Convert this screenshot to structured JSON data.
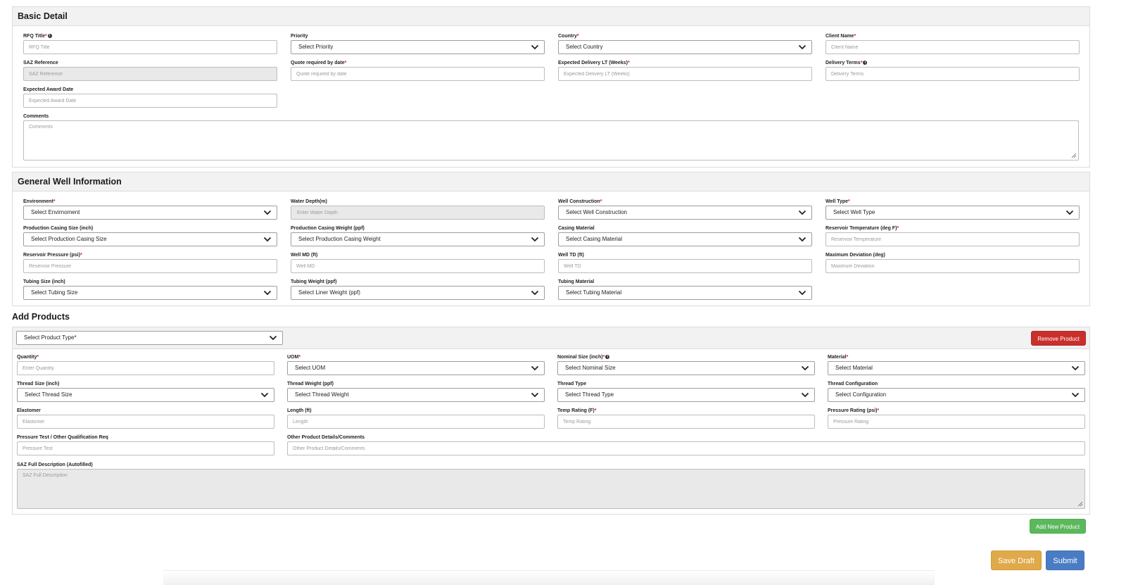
{
  "basic": {
    "title": "Basic Detail",
    "rfq_title": {
      "label": "RFQ Title",
      "placeholder": "RFQ Title"
    },
    "priority": {
      "label": "Priority",
      "value": "Select Priority"
    },
    "country": {
      "label": "Country",
      "value": "Select Country"
    },
    "client_name": {
      "label": "Client Name",
      "placeholder": "Client Name"
    },
    "saz_reference": {
      "label": "SAZ Reference",
      "placeholder": "SAZ Reference"
    },
    "quote_date": {
      "label": "Quote required by date",
      "placeholder": "Quote required by date"
    },
    "delivery_lt": {
      "label": "Expected Delivery LT (Weeks)",
      "placeholder": "Expected Delivery LT (Weeks)"
    },
    "delivery_terms": {
      "label": "Delivery Terms",
      "placeholder": "Delivery Terms"
    },
    "award_date": {
      "label": "Expected Award Date",
      "placeholder": "Expected Award Date"
    },
    "comments": {
      "label": "Comments",
      "placeholder": "Comments"
    }
  },
  "well": {
    "title": "General Well Information",
    "environment": {
      "label": "Environment",
      "value": "Select Envirnoment"
    },
    "water_depth": {
      "label": "Water Depth(m)",
      "placeholder": "Enter Water Depth"
    },
    "well_construction": {
      "label": "Well Construction",
      "value": "Select Well Construction"
    },
    "well_type": {
      "label": "Well Type",
      "value": "Select Well Type"
    },
    "casing_size": {
      "label": "Production Casing Size (inch)",
      "value": "Select Production Casing Size"
    },
    "casing_weight": {
      "label": "Production Casing Weight (ppf)",
      "value": "Select Production Casing Weight"
    },
    "casing_material": {
      "label": "Casing Material",
      "value": "Select Casing Material"
    },
    "reservoir_temp": {
      "label": "Reservoir Temperature (deg F)",
      "placeholder": "Reservoir Temperature"
    },
    "reservoir_pressure": {
      "label": "Reservoir Pressure (psi)",
      "placeholder": "Reservoir Pressure"
    },
    "well_md": {
      "label": "Well MD (ft)",
      "placeholder": "Well MD"
    },
    "well_td": {
      "label": "Well TD (ft)",
      "placeholder": "Well TD"
    },
    "max_deviation": {
      "label": "Maximum Deviation (deg)",
      "placeholder": "Maximum Deviation"
    },
    "tubing_size": {
      "label": "Tubing Size (inch)",
      "value": "Select Tubing Size"
    },
    "tubing_weight": {
      "label": "Tubing Weight (ppf)",
      "value": "Select Liner Weight (ppf)"
    },
    "tubing_material": {
      "label": "Tubing Material",
      "value": "Select Tubing Material"
    }
  },
  "products": {
    "title": "Add Products",
    "product_type": {
      "value": "Select Product Type*"
    },
    "remove_label": "Remove Product",
    "quantity": {
      "label": "Quantity",
      "placeholder": "Enter Quantity"
    },
    "uom": {
      "label": "UOM",
      "value": "Select UOM"
    },
    "nominal_size": {
      "label": "Nominal Size (inch)",
      "value": "Select Nominal Size"
    },
    "material": {
      "label": "Material",
      "value": "Select Material"
    },
    "thread_size": {
      "label": "Thread Size (inch)",
      "value": "Select Thread Size"
    },
    "thread_weight": {
      "label": "Thread Weight (ppf)",
      "value": "Select Thread Weight"
    },
    "thread_type": {
      "label": "Thread Type",
      "value": "Select Thread Type"
    },
    "thread_config": {
      "label": "Thread Configuration",
      "value": "Select Configuration"
    },
    "elastomer": {
      "label": "Elastomer",
      "placeholder": "Elastomer"
    },
    "length": {
      "label": "Length (ft)",
      "placeholder": "Length"
    },
    "temp_rating": {
      "label": "Temp Rating (F)",
      "placeholder": "Temp Rating"
    },
    "pressure_rating": {
      "label": "Pressure Rating (psi)",
      "placeholder": "Pressure Rating"
    },
    "pressure_test": {
      "label": "Pressure Test / Other Qualification Req",
      "placeholder": "Pressure Test"
    },
    "other_details": {
      "label": "Other Product Details/Comments",
      "placeholder": "Other Product Details/Comments"
    },
    "saz_description": {
      "label": "SAZ Full Description (Autofilled)",
      "placeholder": "SAZ Full Description"
    },
    "add_label": "Add New Product"
  },
  "actions": {
    "save_draft_label": "Save Draft",
    "submit_label": "Submit"
  },
  "colors": {
    "remove": "#c9302c",
    "add": "#5cb85c",
    "save_draft": "#e0a94a",
    "submit": "#4a7cc4",
    "required": "#c62828"
  }
}
